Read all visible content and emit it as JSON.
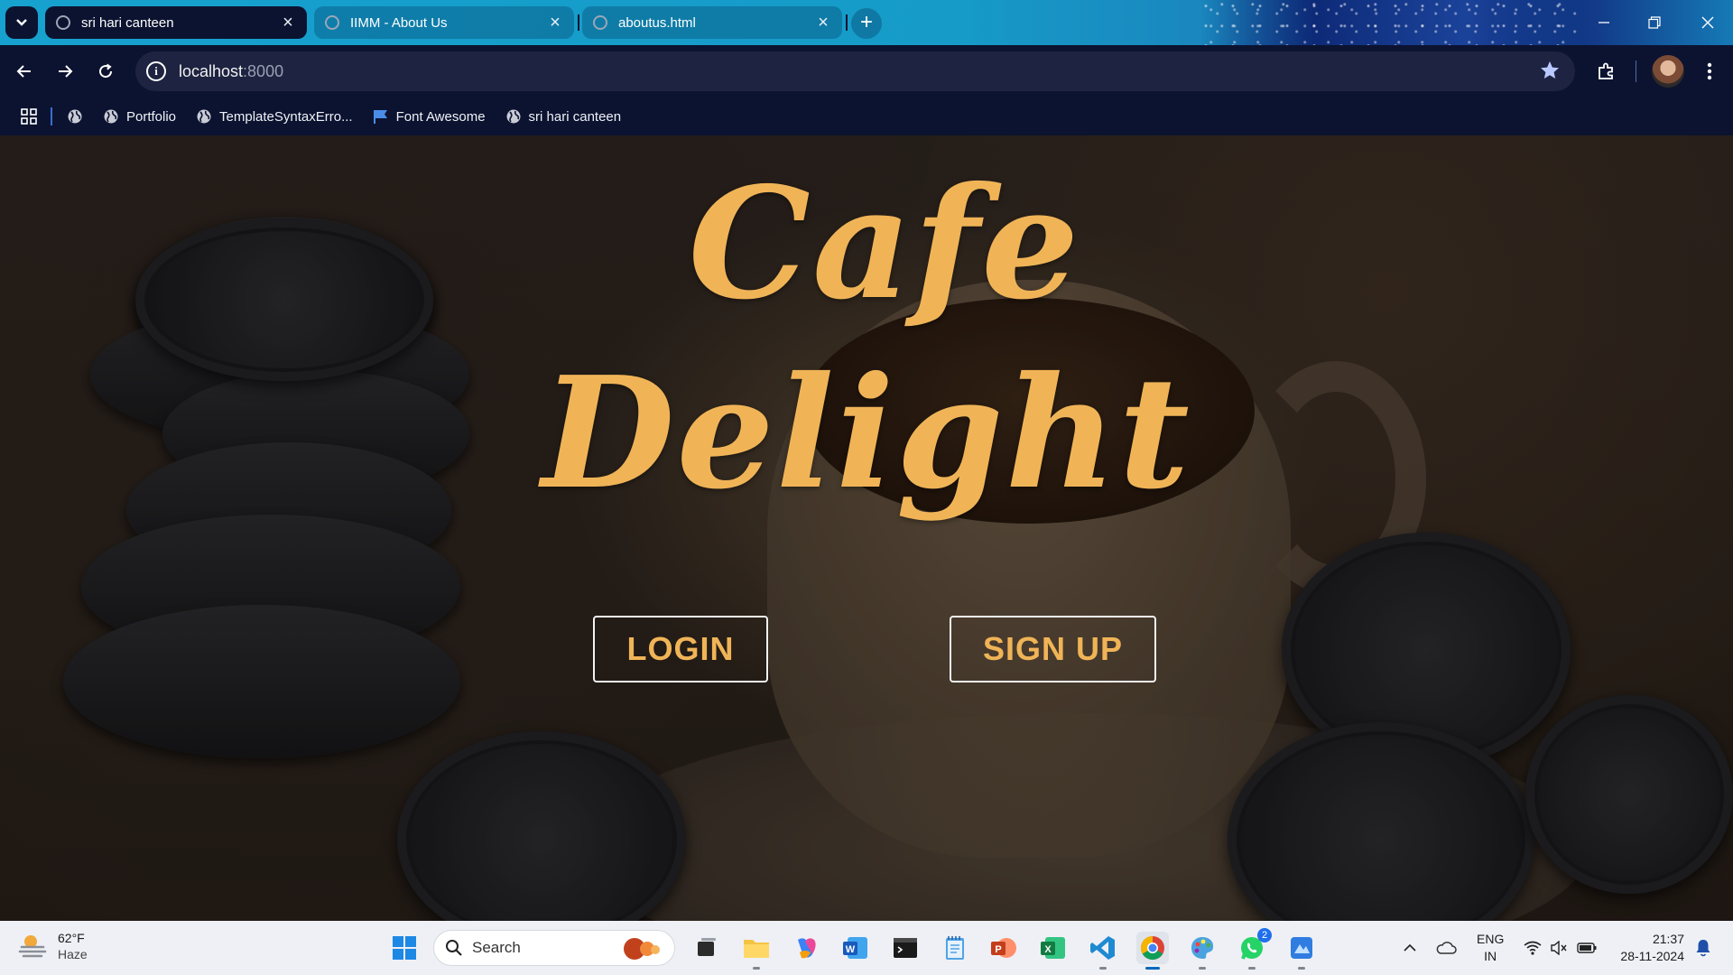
{
  "browser": {
    "tabs": [
      {
        "label": "sri hari canteen",
        "active": true
      },
      {
        "label": "IIMM - About Us",
        "active": false
      },
      {
        "label": "aboutus.html",
        "active": false
      }
    ],
    "new_tab_symbol": "+",
    "address": {
      "host": "localhost",
      "port": ":8000"
    },
    "bookmarks": [
      {
        "label": "",
        "icon": "globe-icon"
      },
      {
        "label": "Portfolio",
        "icon": "globe-icon"
      },
      {
        "label": "TemplateSyntaxErro...",
        "icon": "globe-icon"
      },
      {
        "label": "Font Awesome",
        "icon": "flag-icon"
      },
      {
        "label": "sri hari canteen",
        "icon": "globe-icon"
      }
    ]
  },
  "hero": {
    "title_line1": "Cafe",
    "title_line2": "Delight",
    "login_label": "LOGIN",
    "signup_label": "SIGN UP",
    "accent_color": "#f0b457"
  },
  "taskbar": {
    "weather": {
      "temp": "62°F",
      "condition": "Haze"
    },
    "search_label": "Search",
    "apps": [
      "start",
      "search",
      "task-view",
      "file-explorer",
      "copilot",
      "word",
      "terminal",
      "notepad",
      "powerpoint",
      "excel",
      "vscode",
      "chrome",
      "paint",
      "whatsapp",
      "app"
    ],
    "whatsapp_badge": "2",
    "lang": {
      "line1": "ENG",
      "line2": "IN"
    },
    "clock": {
      "time": "21:37",
      "date": "28-11-2024"
    }
  }
}
